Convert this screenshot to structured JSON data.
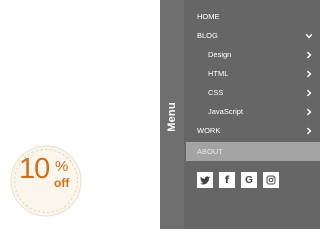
{
  "menu_tab": {
    "label": "Menu"
  },
  "nav": {
    "items": [
      {
        "label": "HOME",
        "level": 0,
        "chevron": "none",
        "active": false
      },
      {
        "label": "BLOG",
        "level": 0,
        "chevron": "down",
        "active": false
      },
      {
        "label": "Design",
        "level": 1,
        "chevron": "right",
        "active": false
      },
      {
        "label": "HTML",
        "level": 1,
        "chevron": "right",
        "active": false
      },
      {
        "label": "CSS",
        "level": 1,
        "chevron": "right",
        "active": false
      },
      {
        "label": "JavaScript",
        "level": 1,
        "chevron": "right",
        "active": false
      },
      {
        "label": "WORK",
        "level": 0,
        "chevron": "right",
        "active": false
      },
      {
        "label": "ABOUT",
        "level": 0,
        "chevron": "none",
        "active": true
      }
    ]
  },
  "social": {
    "icons": [
      "twitter-icon",
      "facebook-icon",
      "google-icon",
      "instagram-icon"
    ],
    "google_letter": "G",
    "facebook_letter": "f"
  },
  "badge": {
    "number": "10",
    "percent": "%",
    "off": "off"
  },
  "colors": {
    "panel": "#666666",
    "tab": "#6f6f6f",
    "active_item": "#a3a3a3",
    "badge_text": "#d26e1e",
    "badge_fill": "#fbf6ec"
  }
}
